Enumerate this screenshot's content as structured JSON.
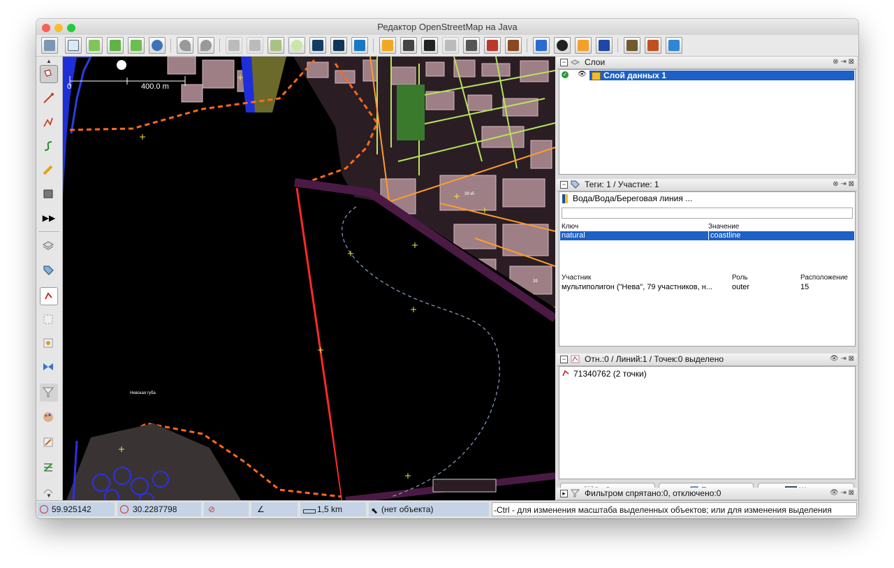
{
  "window": {
    "title": "Редактор OpenStreetMap на Java"
  },
  "toolbar": {
    "buttons": [
      "open",
      "download",
      "download-along",
      "download-data",
      "upload",
      "upload-notes",
      "undo",
      "redo",
      "copy",
      "paste",
      "wms",
      "zoom",
      "osm-map",
      "imagery",
      "bing",
      "layer-1",
      "layer-2",
      "layer-3",
      "layer-4",
      "layer-5",
      "layer-6",
      "layer-7",
      "building",
      "football",
      "shop",
      "info",
      "landuse",
      "mountain",
      "river"
    ]
  },
  "map": {
    "scale_label": "400.0 m",
    "scale_zero": "0",
    "place_label": "Невская губа",
    "house_label_1": "39 к5",
    "house_label_2": "39"
  },
  "panels": {
    "layers": {
      "title": "Слои",
      "items": [
        {
          "name": "Слой данных 1",
          "selected": true
        }
      ]
    },
    "tags": {
      "title": "Теги: 1 / Участие: 1",
      "preset": "Вода/Вода/Береговая линия ...",
      "search_value": "",
      "key_header": "Ключ",
      "value_header": "Значение",
      "rows": [
        {
          "key": "natural",
          "value": "coastline"
        }
      ],
      "member_header": "Участник",
      "role_header": "Роль",
      "position_header": "Расположение",
      "members": [
        {
          "member": "мультиполигон (\"Нева\", 79 участников, н...",
          "role": "outer",
          "position": "15"
        }
      ]
    },
    "selection": {
      "title": "Отн.:0 / Линий:1 / Точек:0 выделено",
      "items": [
        "71340762 (2 точки)"
      ],
      "buttons": {
        "select": "Выбор",
        "search": "Поиск",
        "history": "Журнал"
      }
    },
    "filter": {
      "title": "Фильтром спрятано:0, отключено:0"
    }
  },
  "status": {
    "lat": "59.925142",
    "lon": "30.2287798",
    "distance": "1,5 km",
    "object": "(нет объекта)",
    "help": "-Ctrl - для изменения масштаба выделенных объектов; или для изменения выделения"
  }
}
